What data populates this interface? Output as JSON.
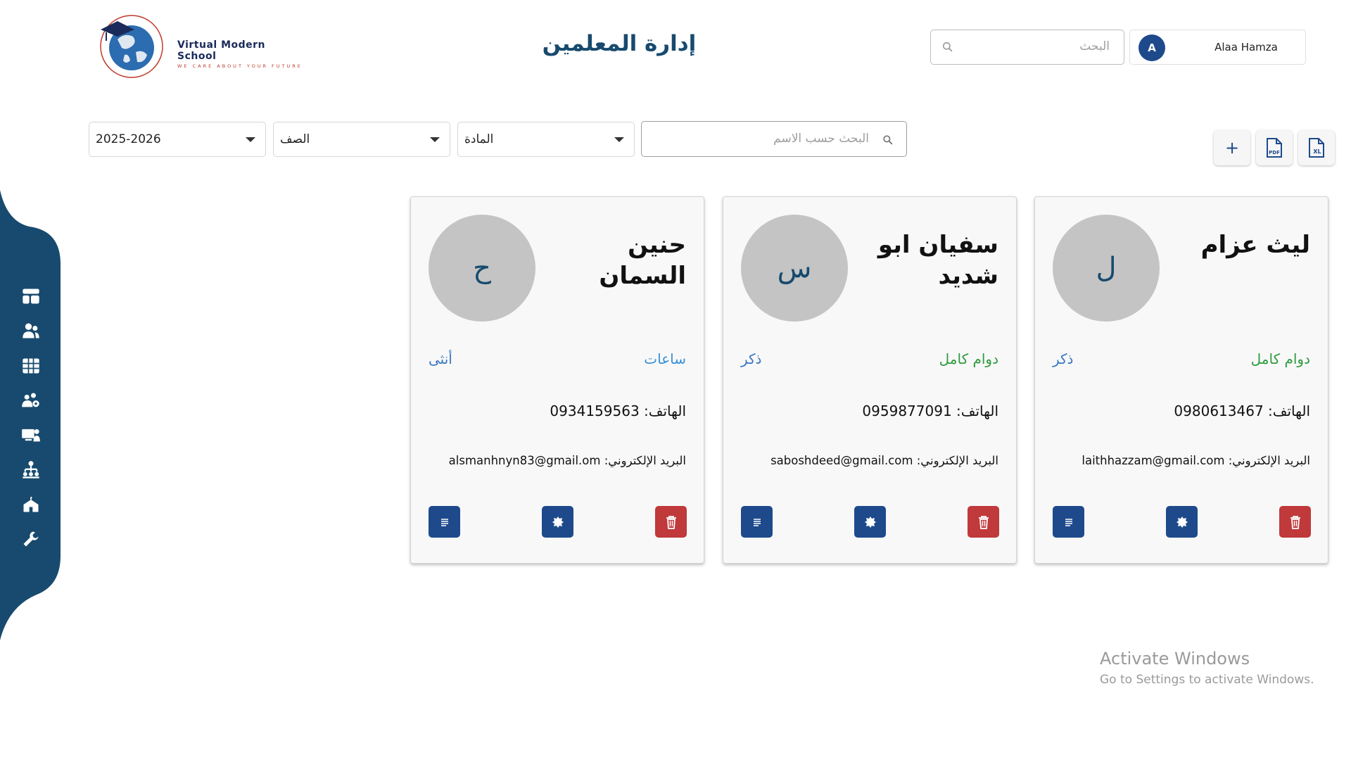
{
  "header": {
    "logo_name": "Virtual Modern School",
    "logo_tagline": "WE CARE ABOUT YOUR FUTURE",
    "page_title": "إدارة المعلمين",
    "search_placeholder": "البحث",
    "user": {
      "initial": "A",
      "name": "Alaa Hamza"
    }
  },
  "filters": {
    "year": "2025-2026",
    "class": "الصف",
    "subject": "المادة",
    "name_search_placeholder": "البحث حسب الاسم"
  },
  "toolbar": {
    "add_label": "+",
    "pdf_label": "PDF",
    "excel_label": "XL"
  },
  "sidebar": {
    "items": [
      "dashboard-icon",
      "users-icon",
      "table-icon",
      "group-settings-icon",
      "classroom-icon",
      "hierarchy-icon",
      "school-icon",
      "wrench-icon"
    ]
  },
  "teachers": [
    {
      "name": "ليث عزام",
      "initial": "ل",
      "type": "دوام كامل",
      "type_color": "#2e9b3e",
      "gender": "ذكر",
      "phone": "الهاتف: 0980613467",
      "email": "البريد الإلكتروني: laithhazzam@gmail.com"
    },
    {
      "name": "سفيان ابو شديد",
      "initial": "س",
      "type": "دوام كامل",
      "type_color": "#2e9b3e",
      "gender": "ذكر",
      "phone": "الهاتف: 0959877091",
      "email": "البريد الإلكتروني: saboshdeed@gmail.com"
    },
    {
      "name": "حنين السمان",
      "initial": "ح",
      "type": "ساعات",
      "type_color": "#3a8fd6",
      "gender": "أنثى",
      "phone": "الهاتف: 0934159563",
      "email": "البريد الإلكتروني: alsmanhnyn83@gmail.om"
    }
  ],
  "watermark": {
    "line1": "Activate Windows",
    "line2": "Go to Settings to activate Windows."
  },
  "colors": {
    "primary": "#1e4a8c",
    "sidebar": "#174a6e",
    "danger": "#c0393b"
  }
}
